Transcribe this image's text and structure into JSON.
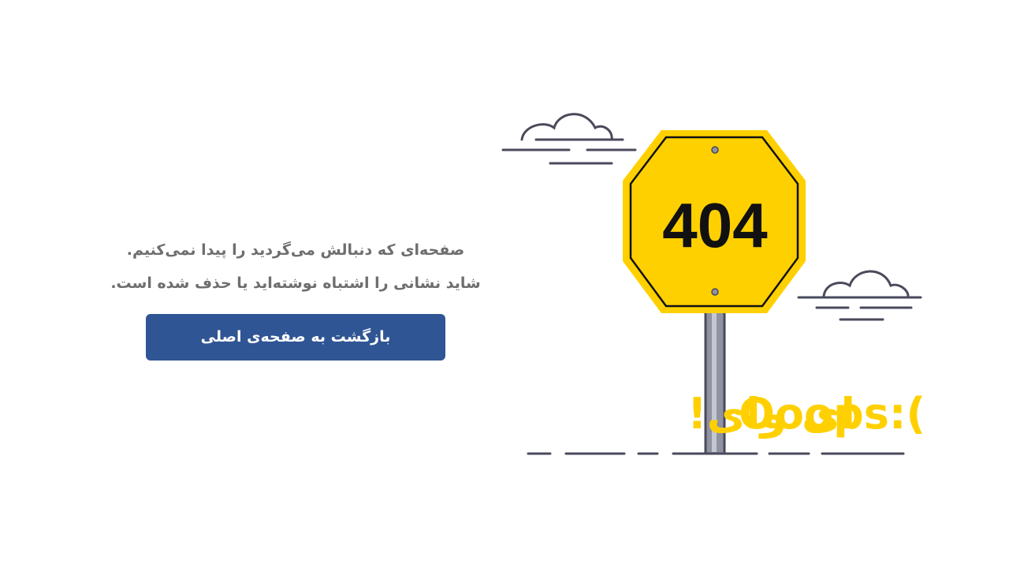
{
  "message": {
    "line1": "صفحه‌ای که دنبالش می‌گردید را پیدا نمی‌کنیم.",
    "line2": "شاید نشانی را اشتباه نوشته‌اید یا حذف شده است."
  },
  "home_button": {
    "label": "بازگشت به صفحه‌ی اصلی"
  },
  "sign": {
    "code": "404"
  },
  "caption": {
    "persian": "ای وای!",
    "english": "Ooops:("
  },
  "colors": {
    "sign_yellow": "#ffd000",
    "outline": "#4a4a5c",
    "button": "#2f5594",
    "text_gray": "#6e6e6e"
  }
}
